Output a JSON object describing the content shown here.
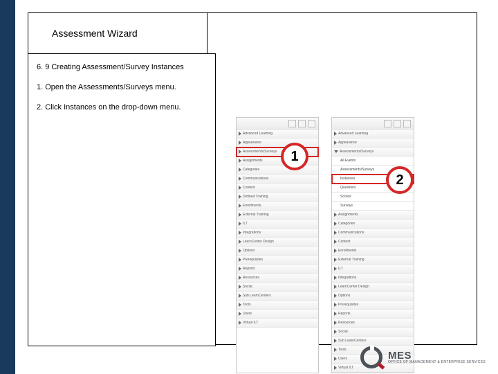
{
  "title": "Assessment Wizard",
  "heading": "6. 9 Creating Assessment/Survey Instances",
  "steps": [
    "1. Open the Assessments/Surveys menu.",
    "2. Click Instances on the drop-down menu."
  ],
  "menus": {
    "left": [
      "Advanced Learning",
      "Appearance",
      "Assessments/Surveys",
      "Assignments",
      "Categories",
      "Communications",
      "Content",
      "Defined Training",
      "Enrollments",
      "External Training",
      "ILT",
      "Integrations",
      "LearnCenter Design",
      "Options",
      "Prerequisites",
      "Reports",
      "Resources",
      "Social",
      "Sub LearnCenters",
      "Tools",
      "Users",
      "Virtual ILT"
    ],
    "right_top": [
      "Advanced Learning",
      "Appearance"
    ],
    "right_header": "Assessments/Surveys",
    "right_sub": [
      "All Events",
      "Assessments/Surveys",
      "Instances",
      "Questions",
      "Scores",
      "Surveys"
    ],
    "right_bottom": [
      "Assignments",
      "Categories",
      "Communications",
      "Content",
      "Enrollments",
      "External Training",
      "ILT",
      "Integrations",
      "LearnCenter Design",
      "Options",
      "Prerequisites",
      "Reports",
      "Resources",
      "Social",
      "Sub LearnCenters",
      "Tools",
      "Users",
      "Virtual ILT"
    ]
  },
  "highlight": {
    "left_index": 2,
    "right_sub_index": 2
  },
  "callouts": {
    "one": "1",
    "two": "2"
  },
  "brand": {
    "name": "MES",
    "sub": "OFFICE OF MANAGEMENT & ENTERPRISE SERVICES"
  }
}
